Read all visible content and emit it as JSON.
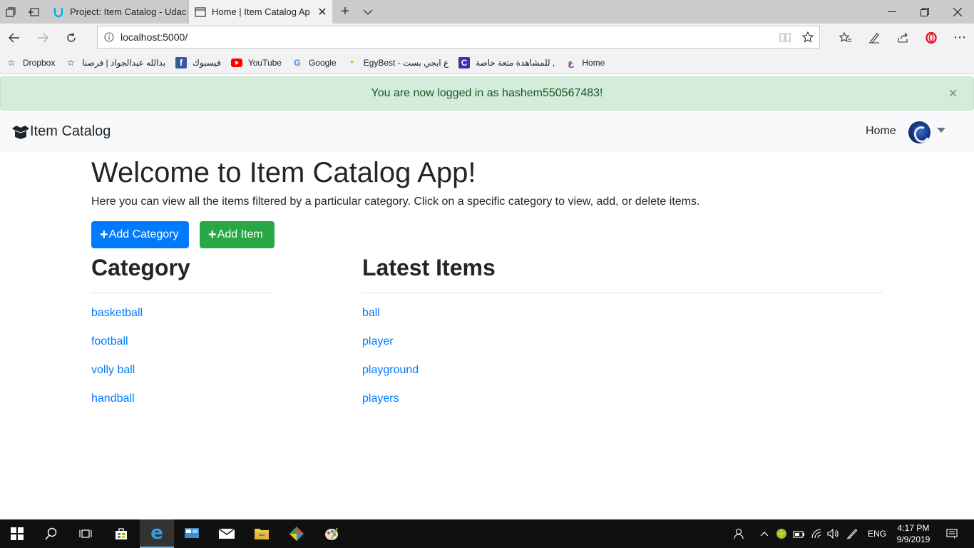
{
  "browser": {
    "tabs": [
      {
        "title": "Project: Item Catalog - Udac",
        "active": false
      },
      {
        "title": "Home | Item Catalog Ap",
        "active": true
      }
    ],
    "address": "localhost:5000/",
    "favorites": [
      {
        "label": "Dropbox",
        "icon": "star-icon"
      },
      {
        "label": "بدالله عبدالجواد | فرصنا",
        "icon": "star-icon"
      },
      {
        "label": "فيسبوك",
        "icon": "facebook-icon"
      },
      {
        "label": "YouTube",
        "icon": "youtube-icon"
      },
      {
        "label": "Google",
        "icon": "google-icon"
      },
      {
        "label": "EgyBest - ع ايجي بست",
        "icon": "egybest-icon"
      },
      {
        "label": "للمشاهدة متعة خاصة ,",
        "icon": "c-icon"
      },
      {
        "label": "Home",
        "icon": "home-fav-icon"
      }
    ]
  },
  "alert": {
    "message": "You are now logged in as hashem550567483!",
    "close": "×"
  },
  "site_nav": {
    "brand": "Item Catalog",
    "home": "Home"
  },
  "main": {
    "heading": "Welcome to Item Catalog App!",
    "lead": "Here you can view all the items filtered by a particular category. Click on a specific category to view, add, or delete items.",
    "add_category": "Add Category",
    "add_item": "Add Item",
    "category_title": "Category",
    "categories": [
      "basketball",
      "football",
      "volly ball",
      "handball"
    ],
    "latest_title": "Latest Items",
    "items": [
      "ball",
      "player",
      "playground",
      "players"
    ]
  },
  "taskbar": {
    "lang": "ENG",
    "time": "4:17 PM",
    "date": "9/9/2019"
  },
  "colors": {
    "primary": "#007bff",
    "success": "#28a745",
    "alert_bg": "#d4edda",
    "alert_text": "#155724"
  }
}
